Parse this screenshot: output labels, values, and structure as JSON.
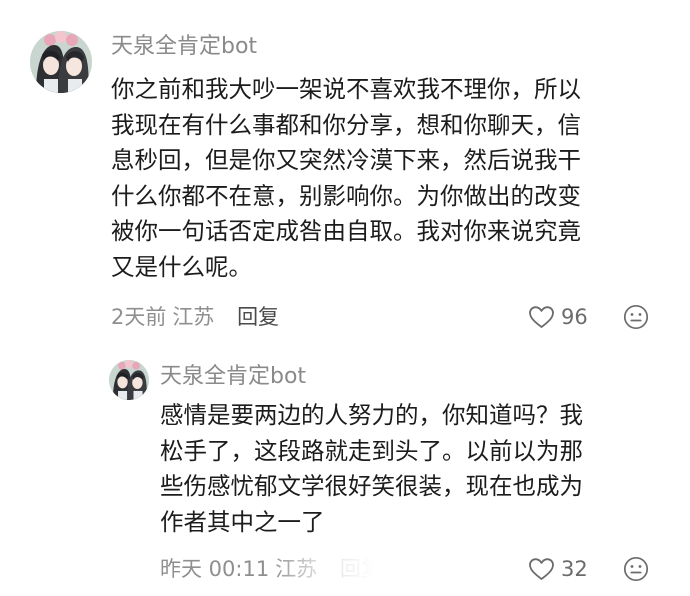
{
  "comments": [
    {
      "username": "天泉全肯定bot",
      "lines": [
        "你之前和我大吵一架说不喜欢我不理你，所以",
        "我现在有什么事都和你分享，想和你聊天，信",
        "息秒回，但是你又突然冷漠下来，然后说我干",
        "什么你都不在意，别影响你。为你做出的改变",
        "被你一句话否定成咎由自取。我对你来说究竟",
        "又是什么呢。"
      ],
      "time": "2天前",
      "location": "江苏",
      "reply_label": "回复",
      "likes": "96",
      "like_icon": "heart-outline-icon",
      "more_icon": "emoji-icon"
    },
    {
      "username": "天泉全肯定bot",
      "lines": [
        "感情是要两边的人努力的，你知道吗？我",
        "松手了，这段路就走到头了。以前以为那",
        "些伤感忧郁文学很好笑很装，现在也成为",
        "作者其中之一了"
      ],
      "time": "昨天 00:11",
      "location": "江苏",
      "reply_label": "回复",
      "likes": "32",
      "like_icon": "heart-outline-icon",
      "more_icon": "emoji-icon"
    }
  ],
  "colors": {
    "username": "#8a8a8a",
    "body": "#1c1c1c",
    "meta": "#8f8f8f"
  }
}
